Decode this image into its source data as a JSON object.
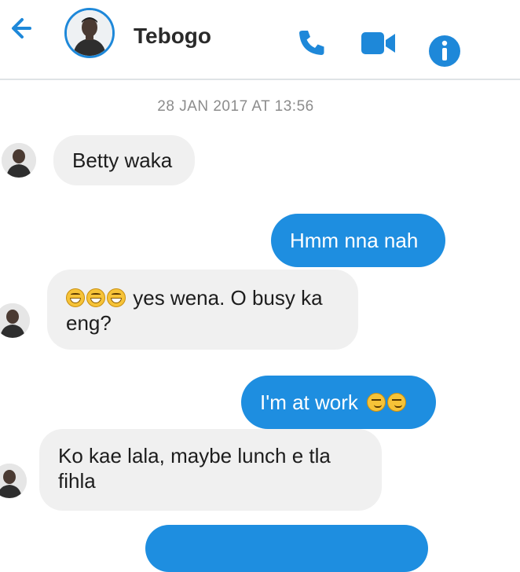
{
  "header": {
    "contact_name": "Tebogo",
    "accent_color": "#1e88d9",
    "icons": [
      "back-arrow-icon",
      "phone-icon",
      "video-camera-icon",
      "info-icon"
    ]
  },
  "conversation": {
    "date_stamp": "28 JAN 2017 AT 13:56",
    "messages": [
      {
        "direction": "incoming",
        "text": "Betty waka"
      },
      {
        "direction": "outgoing",
        "text": "Hmm nna nah"
      },
      {
        "direction": "incoming",
        "emoji_prefix": "grinning-face x3",
        "line1": "yes wena. O busy ka",
        "line2": "eng?"
      },
      {
        "direction": "outgoing",
        "text": "I'm at work",
        "emoji_suffix": "smirking-face x2"
      },
      {
        "direction": "incoming",
        "line1": "Ko kae lala, maybe lunch e tla",
        "line2": "fihla"
      }
    ]
  }
}
